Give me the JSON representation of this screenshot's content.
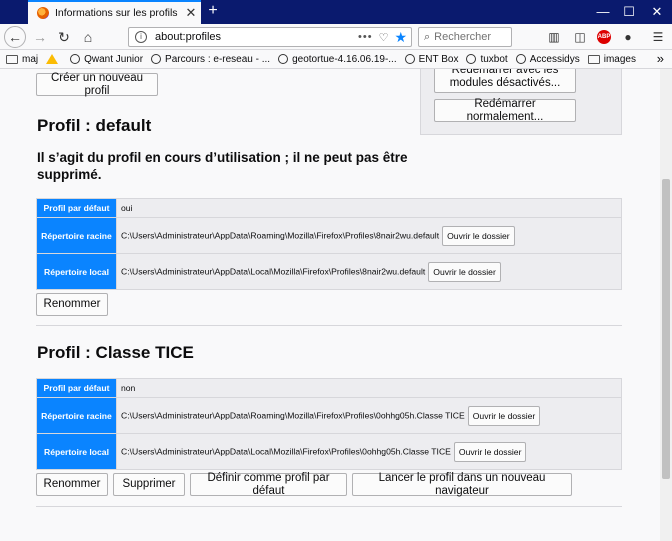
{
  "browser": {
    "tab_title": "Informations sur les profils",
    "tab_close": "✕",
    "new_tab": "+",
    "win_min": "—",
    "win_max": "☐",
    "win_close": "✕",
    "url": "about:profiles",
    "url_actions": "•••",
    "search_placeholder": "Rechercher",
    "bookmarks": [
      "maj",
      "",
      "Qwant Junior",
      "Parcours : e-reseau - ...",
      "geotortue-4.16.06.19-...",
      "ENT Box",
      "tuxbot",
      "Accessidys",
      "images"
    ],
    "bookmarks_more": "»"
  },
  "page": {
    "create_profile": "Créer un nouveau profil",
    "restart_no_modules": "Redémarrer avec les modules désactivés...",
    "restart_normal": "Redémarrer normalement...",
    "profile1": {
      "title": "Profil : default",
      "warning": "Il s’agit du profil en cours d’utilisation ; il ne peut pas être supprimé.",
      "rows": [
        {
          "label": "Profil par défaut",
          "value": "oui"
        },
        {
          "label": "Répertoire racine",
          "value": "C:\\Users\\Administrateur\\AppData\\Roaming\\Mozilla\\Firefox\\Profiles\\8nair2wu.default",
          "button": "Ouvrir le dossier"
        },
        {
          "label": "Répertoire local",
          "value": "C:\\Users\\Administrateur\\AppData\\Local\\Mozilla\\Firefox\\Profiles\\8nair2wu.default",
          "button": "Ouvrir le dossier"
        }
      ],
      "rename": "Renommer"
    },
    "profile2": {
      "title": "Profil : Classe TICE",
      "rows": [
        {
          "label": "Profil par défaut",
          "value": "non"
        },
        {
          "label": "Répertoire racine",
          "value": "C:\\Users\\Administrateur\\AppData\\Roaming\\Mozilla\\Firefox\\Profiles\\0ohhg05h.Classe TICE",
          "button": "Ouvrir le dossier"
        },
        {
          "label": "Répertoire local",
          "value": "C:\\Users\\Administrateur\\AppData\\Local\\Mozilla\\Firefox\\Profiles\\0ohhg05h.Classe TICE",
          "button": "Ouvrir le dossier"
        }
      ],
      "rename": "Renommer",
      "delete": "Supprimer",
      "set_default": "Définir comme profil par défaut",
      "launch": "Lancer le profil dans un nouveau navigateur"
    }
  }
}
